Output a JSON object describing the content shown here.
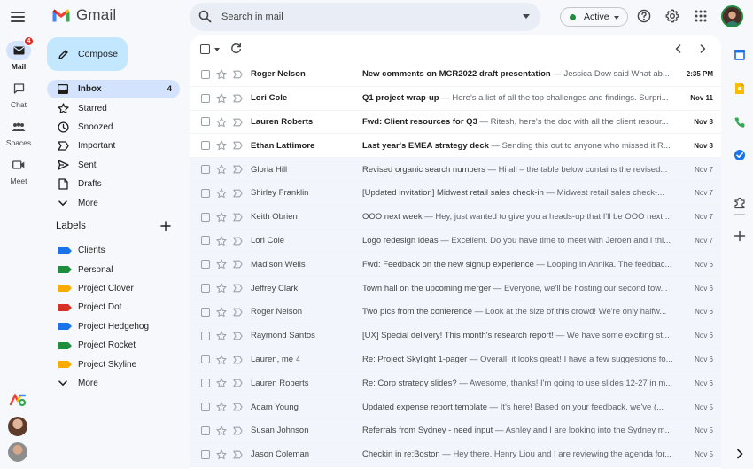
{
  "app": {
    "name": "Gmail"
  },
  "colors": {
    "accent": "#0b57d0",
    "active_bg": "#d3e3fd",
    "compose_bg": "#c2e7ff",
    "status_green": "#1e8e3e"
  },
  "rail": {
    "items": [
      {
        "label": "Mail",
        "icon": "mail-icon",
        "badge": "4",
        "active": true
      },
      {
        "label": "Chat",
        "icon": "chat-icon"
      },
      {
        "label": "Spaces",
        "icon": "spaces-icon"
      },
      {
        "label": "Meet",
        "icon": "meet-icon"
      }
    ]
  },
  "search": {
    "placeholder": "Search in mail"
  },
  "status": {
    "label": "Active"
  },
  "compose": {
    "label": "Compose"
  },
  "nav": {
    "items": [
      {
        "label": "Inbox",
        "icon": "inbox-icon",
        "count": "4",
        "active": true
      },
      {
        "label": "Starred",
        "icon": "star-icon"
      },
      {
        "label": "Snoozed",
        "icon": "clock-icon"
      },
      {
        "label": "Important",
        "icon": "important-icon"
      },
      {
        "label": "Sent",
        "icon": "send-icon"
      },
      {
        "label": "Drafts",
        "icon": "draft-icon"
      },
      {
        "label": "More",
        "icon": "chevron-down-icon"
      }
    ]
  },
  "labels": {
    "title": "Labels",
    "items": [
      {
        "label": "Clients",
        "color": "#1a73e8"
      },
      {
        "label": "Personal",
        "color": "#1e8e3e"
      },
      {
        "label": "Project Clover",
        "color": "#f9ab00"
      },
      {
        "label": "Project Dot",
        "color": "#d93025"
      },
      {
        "label": "Project Hedgehog",
        "color": "#1a73e8"
      },
      {
        "label": "Project Rocket",
        "color": "#1e8e3e"
      },
      {
        "label": "Project Skyline",
        "color": "#f9ab00"
      }
    ],
    "more": "More"
  },
  "emails": [
    {
      "sender": "Roger Nelson",
      "subject": "New comments on MCR2022 draft presentation",
      "snippet": " — Jessica Dow said What ab...",
      "date": "2:35 PM",
      "unread": true
    },
    {
      "sender": "Lori Cole",
      "subject": "Q1 project wrap-up",
      "snippet": " — Here's a list of all the top challenges and findings. Surpri...",
      "date": "Nov 11",
      "unread": true
    },
    {
      "sender": "Lauren Roberts",
      "subject": "Fwd: Client resources for Q3",
      "snippet": " — Ritesh, here's the doc with all the client resour...",
      "date": "Nov 8",
      "unread": true
    },
    {
      "sender": "Ethan Lattimore",
      "subject": "Last year's EMEA strategy deck",
      "snippet": " — Sending this out to anyone who missed it R...",
      "date": "Nov 8",
      "unread": true
    },
    {
      "sender": "Gloria Hill",
      "subject": "Revised organic search numbers",
      "snippet": " — Hi all – the table below contains the revised...",
      "date": "Nov 7",
      "unread": false
    },
    {
      "sender": "Shirley Franklin",
      "subject": "[Updated invitation] Midwest retail sales check-in",
      "snippet": " — Midwest retail sales check-...",
      "date": "Nov 7",
      "unread": false
    },
    {
      "sender": "Keith Obrien",
      "subject": "OOO next week",
      "snippet": " — Hey, just wanted to give you a heads-up that I'll be OOO next...",
      "date": "Nov 7",
      "unread": false
    },
    {
      "sender": "Lori Cole",
      "subject": "Logo redesign ideas",
      "snippet": " — Excellent. Do you have time to meet with Jeroen and I thi...",
      "date": "Nov 7",
      "unread": false
    },
    {
      "sender": "Madison Wells",
      "subject": "Fwd: Feedback on the new signup experience",
      "snippet": " — Looping in Annika. The feedbac...",
      "date": "Nov 6",
      "unread": false
    },
    {
      "sender": "Jeffrey Clark",
      "subject": "Town hall on the upcoming merger",
      "snippet": " — Everyone, we'll be hosting our second tow...",
      "date": "Nov 6",
      "unread": false
    },
    {
      "sender": "Roger Nelson",
      "subject": "Two pics from the conference",
      "snippet": " — Look at the size of this crowd! We're only halfw...",
      "date": "Nov 6",
      "unread": false
    },
    {
      "sender": "Raymond Santos",
      "subject": "[UX] Special delivery! This month's research report!",
      "snippet": " — We have some exciting st...",
      "date": "Nov 6",
      "unread": false
    },
    {
      "sender": "Lauren, me",
      "count": "4",
      "subject": "Re: Project Skylight 1-pager",
      "snippet": " — Overall, it looks great! I have a few suggestions fo...",
      "date": "Nov 6",
      "unread": false
    },
    {
      "sender": "Lauren Roberts",
      "subject": "Re: Corp strategy slides?",
      "snippet": " — Awesome, thanks! I'm going to use slides 12-27 in m...",
      "date": "Nov 6",
      "unread": false
    },
    {
      "sender": "Adam Young",
      "subject": "Updated expense report template",
      "snippet": " — It's here! Based on your feedback, we've (...",
      "date": "Nov 5",
      "unread": false
    },
    {
      "sender": "Susan Johnson",
      "subject": "Referrals from Sydney - need input",
      "snippet": " — Ashley and I are looking into the Sydney m...",
      "date": "Nov 5",
      "unread": false
    },
    {
      "sender": "Jason Coleman",
      "subject": "Checkin in re:Boston",
      "snippet": " — Hey there. Henry Liou and I are reviewing the agenda for...",
      "date": "Nov 5",
      "unread": false
    }
  ]
}
